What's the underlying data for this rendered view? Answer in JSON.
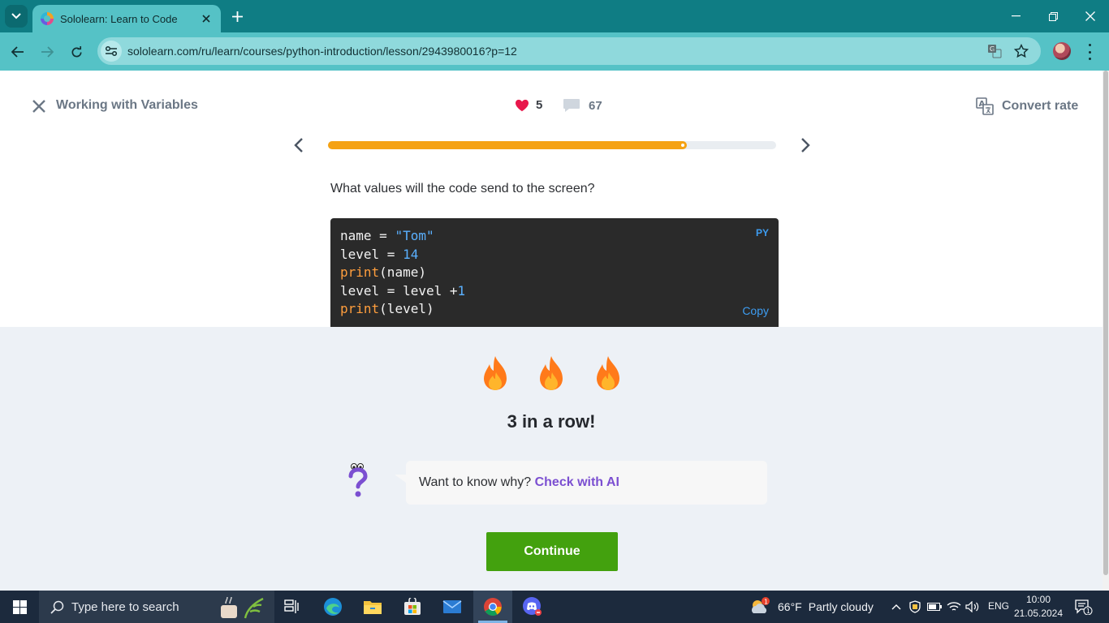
{
  "browser": {
    "tab_title": "Sololearn: Learn to Code",
    "url": "sololearn.com/ru/learn/courses/python-introduction/lesson/2943980016?p=12"
  },
  "lesson": {
    "title": "Working with Variables",
    "likes": "5",
    "comments": "67",
    "convert_label": "Convert rate",
    "progress_fraction": 0.8
  },
  "question": {
    "text": "What values will the code send to the screen?",
    "code_lines": [
      "name = \"Tom\"",
      "level = 14",
      "print(name)",
      "level = level +1",
      "print(level)"
    ],
    "language_badge": "PY",
    "copy_label": "Copy"
  },
  "feedback": {
    "streak_text": "3 in a row!",
    "bubble_prefix": "Want to know why?",
    "bubble_link": "Check with AI",
    "continue_label": "Continue"
  },
  "taskbar": {
    "search_placeholder": "Type here to search",
    "weather_temp": "66°F",
    "weather_desc": "Partly cloudy",
    "weather_badge": "1",
    "language": "ENG",
    "time": "10:00",
    "date": "21.05.2024",
    "notifications": "1"
  },
  "colors": {
    "brand_teal": "#0f7d84",
    "progress": "#f5a213",
    "continue_green": "#43a10e",
    "ai_link": "#7b4fd1"
  },
  "icons": [
    "tab-search-icon",
    "close-icon",
    "plus-icon",
    "back-icon",
    "forward-icon",
    "reload-icon",
    "site-info-icon",
    "translate-icon",
    "star-icon",
    "heart-icon",
    "comment-icon",
    "convert-rate-icon",
    "chevron-left-icon",
    "chevron-right-icon",
    "flame-icon",
    "question-mascot-icon",
    "windows-start-icon",
    "search-icon",
    "edge-icon",
    "explorer-icon",
    "store-icon",
    "mail-icon",
    "chrome-icon",
    "discord-icon"
  ]
}
